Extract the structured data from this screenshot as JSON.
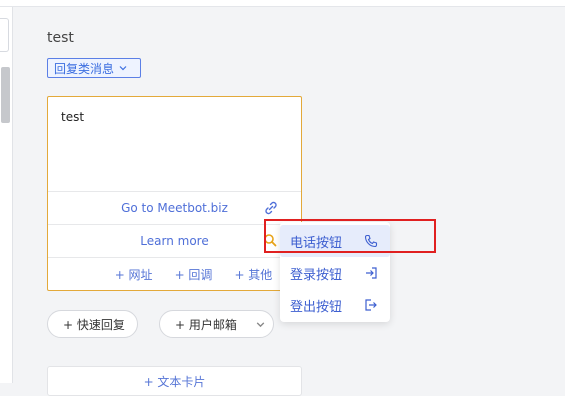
{
  "header": {
    "title": "test"
  },
  "message_type": {
    "label": "回复类消息",
    "chevron": "chevron-down-icon"
  },
  "card": {
    "message_text": "test",
    "link_button": {
      "label": "Go to Meetbot.biz",
      "icon": "link-icon"
    },
    "learn_button": {
      "label": "Learn more",
      "icon": "search-icon"
    },
    "add_actions": [
      "+ 网址",
      "+ 回调",
      "+ 其他"
    ]
  },
  "quick_reply": {
    "label": "+ 快速回复"
  },
  "user_email": {
    "label": "+ 用户邮箱",
    "chevron": "chevron-down-icon"
  },
  "bottom_card": {
    "label": "+ 文本卡片"
  },
  "popup_menu": {
    "items": [
      {
        "label": "电话按钮",
        "icon": "phone-icon",
        "active": true
      },
      {
        "label": "登录按钮",
        "icon": "login-icon",
        "active": false
      },
      {
        "label": "登出按钮",
        "icon": "logout-icon",
        "active": false
      }
    ]
  },
  "colors": {
    "accent": "#3b6ee0",
    "card_border": "#e3a93a",
    "highlight": "#e02020"
  }
}
